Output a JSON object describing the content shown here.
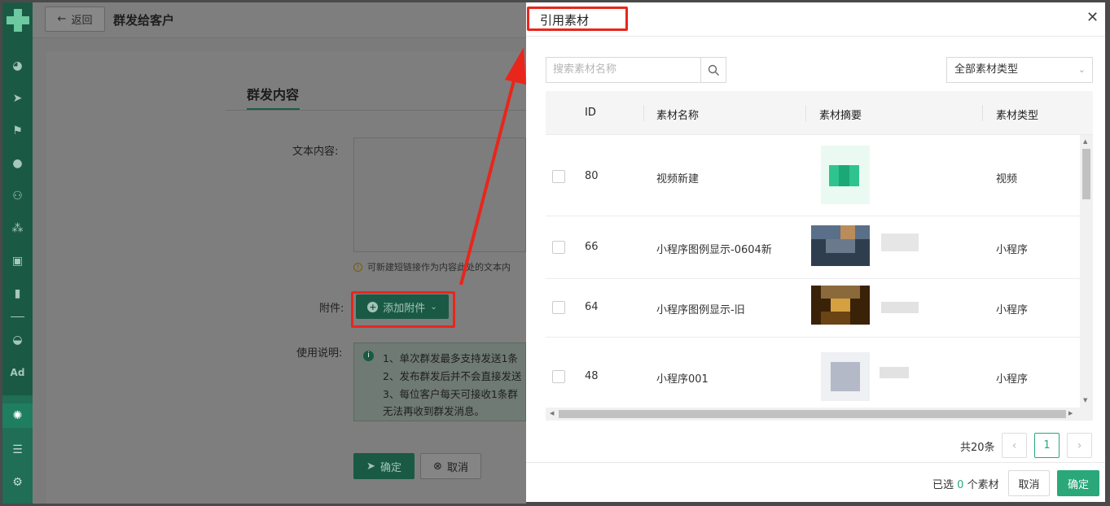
{
  "page": {
    "back_label": "返回",
    "title": "群发给客户",
    "tab_label": "群发内容",
    "text_content_label": "文本内容:",
    "hint": "可新建短链接作为内容此处的文本内",
    "attachment_label": "附件:",
    "add_attachment_label": "添加附件",
    "usage_label": "使用说明:",
    "usage_lines": [
      "1、单次群发最多支持发送1条",
      "2、发布群发后并不会直接发送",
      "3、每位客户每天可接收1条群",
      "无法再收到群发消息。"
    ],
    "confirm_label": "确定",
    "cancel_label": "取消"
  },
  "drawer": {
    "title": "引用素材",
    "search_placeholder": "搜索素材名称",
    "type_select_value": "全部素材类型",
    "columns": [
      "ID",
      "素材名称",
      "素材摘要",
      "素材类型"
    ],
    "rows": [
      {
        "id": "80",
        "name": "视频新建",
        "type": "视频"
      },
      {
        "id": "66",
        "name": "小程序图例显示-0604新",
        "type": "小程序"
      },
      {
        "id": "64",
        "name": "小程序图例显示-旧",
        "type": "小程序"
      },
      {
        "id": "48",
        "name": "小程序001",
        "type": "小程序"
      }
    ],
    "total": "共20条",
    "current_page": "1",
    "selected_prefix": "已选",
    "selected_count": "0",
    "selected_suffix": "个素材",
    "cancel_label": "取消",
    "ok_label": "确定"
  },
  "rail": {
    "ad_label": "Ad"
  },
  "colors": {
    "brand": "#2aa87a",
    "annotation": "#e8261c"
  }
}
